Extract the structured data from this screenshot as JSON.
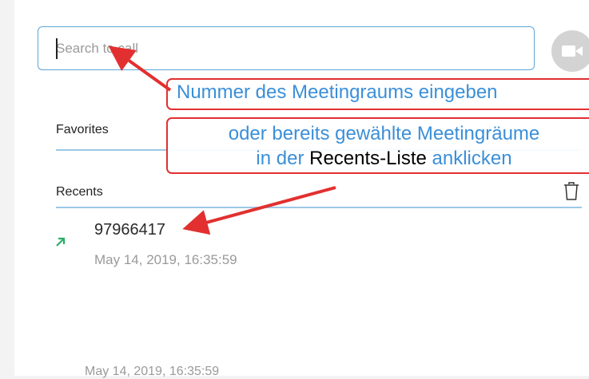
{
  "search": {
    "placeholder": "Search to call"
  },
  "sections": {
    "favorites_label": "Favorites",
    "recents_label": "Recents"
  },
  "recents": [
    {
      "number": "97966417",
      "datetime": "May 14, 2019, 16:35:59",
      "direction_icon": "outgoing-call-arrow-icon"
    }
  ],
  "ghost_text": "May 14, 2019, 16:35:59",
  "annotations": {
    "callout1": "Nummer des Meetingraums eingeben",
    "callout2_line1": "oder bereits gewählte Meetingräume",
    "callout2_line2_pre": "in der ",
    "callout2_line2_black": "Recents-Liste",
    "callout2_line2_post": " anklicken"
  },
  "colors": {
    "accent": "#5aa7d6",
    "annotation_red": "#e23030",
    "annotation_blue": "#3b8fd8",
    "call_arrow_green": "#2eae6a"
  }
}
